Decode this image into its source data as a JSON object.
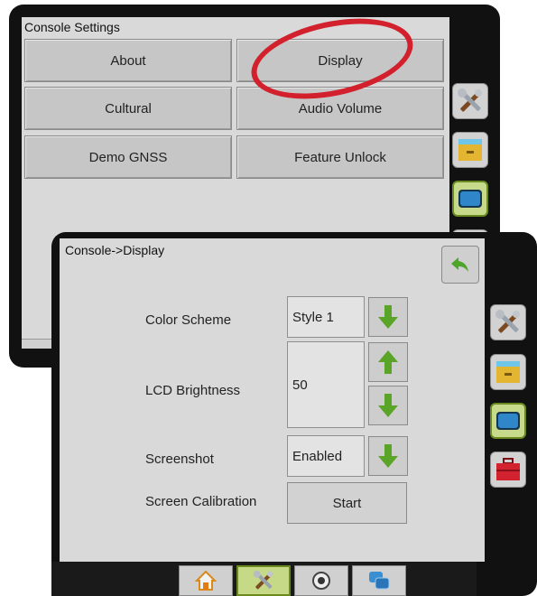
{
  "console_settings": {
    "title": "Console Settings",
    "buttons": [
      {
        "label": "About"
      },
      {
        "label": "Display"
      },
      {
        "label": "Cultural"
      },
      {
        "label": "Audio Volume"
      },
      {
        "label": "Demo GNSS"
      },
      {
        "label": "Feature Unlock"
      }
    ]
  },
  "display_settings": {
    "title": "Console->Display",
    "color_scheme": {
      "label": "Color Scheme",
      "value": "Style 1"
    },
    "lcd_brightness": {
      "label": "LCD Brightness",
      "value": "50"
    },
    "screenshot": {
      "label": "Screenshot",
      "value": "Enabled"
    },
    "screen_calibration": {
      "label": "Screen Calibration",
      "button": "Start"
    }
  },
  "side_tabs": [
    "tools-icon",
    "folder-icon",
    "monitor-icon",
    "toolbox-icon"
  ],
  "bottom_nav": [
    "home-icon",
    "tools-icon",
    "gauge-icon",
    "screens-icon"
  ],
  "colors": {
    "highlight_oval": "#d2202d",
    "active_tab": "#c7d98a",
    "arrow_green": "#5aa428"
  }
}
